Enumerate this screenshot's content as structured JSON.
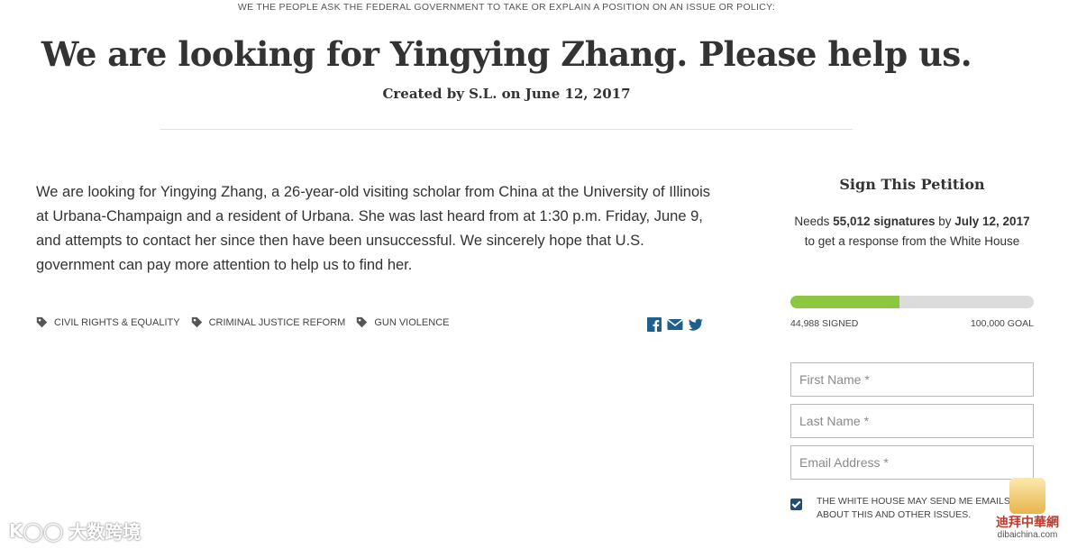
{
  "header": {
    "kicker": "WE THE PEOPLE ASK THE FEDERAL GOVERNMENT TO TAKE OR EXPLAIN A POSITION ON AN ISSUE OR POLICY:",
    "title": "We are looking for Yingying Zhang. Please help us.",
    "created": "Created by S.L. on June 12, 2017"
  },
  "petition": {
    "body": "We are looking for Yingying Zhang, a 26-year-old visiting scholar from China at the University of Illinois at Urbana-Champaign and a resident of Urbana. She was last heard from at 1:30 p.m. Friday, June 9, and attempts to contact her since then have been unsuccessful. We sincerely hope that U.S. government can pay more attention to help us to find her.",
    "tags": [
      {
        "label": "CIVIL RIGHTS & EQUALITY",
        "icon": "tag-icon"
      },
      {
        "label": "CRIMINAL JUSTICE REFORM",
        "icon": "tag-icon"
      },
      {
        "label": "GUN VIOLENCE",
        "icon": "tag-icon"
      }
    ],
    "share_icons": [
      "facebook-icon",
      "email-icon",
      "twitter-icon"
    ]
  },
  "sidebar": {
    "title": "Sign This Petition",
    "needs_prefix": "Needs ",
    "needs_count": "55,012 signatures",
    "needs_by": " by ",
    "needs_date": "July 12, 2017",
    "needs_suffix": " to get a response from the White House",
    "progress": {
      "signed": 44988,
      "goal": 100000,
      "fraction": 0.44988
    },
    "signed_label": "44,988 SIGNED",
    "goal_label": "100,000 GOAL",
    "fields": {
      "first_name": "First Name *",
      "last_name": "Last Name *",
      "email": "Email Address *"
    },
    "consent_text": "THE WHITE HOUSE MAY SEND ME EMAILS ABOUT THIS AND OTHER ISSUES.",
    "consent_checked": true
  },
  "watermarks": {
    "left_text": "大数跨境",
    "right_cn": "迪拜中華網",
    "right_en": "dibaichina.com"
  },
  "colors": {
    "progress_fill": "#8dc63f",
    "progress_track": "#dcdcdc",
    "share_blue": "#1f5f8b",
    "checkbox": "#1f4e79"
  }
}
